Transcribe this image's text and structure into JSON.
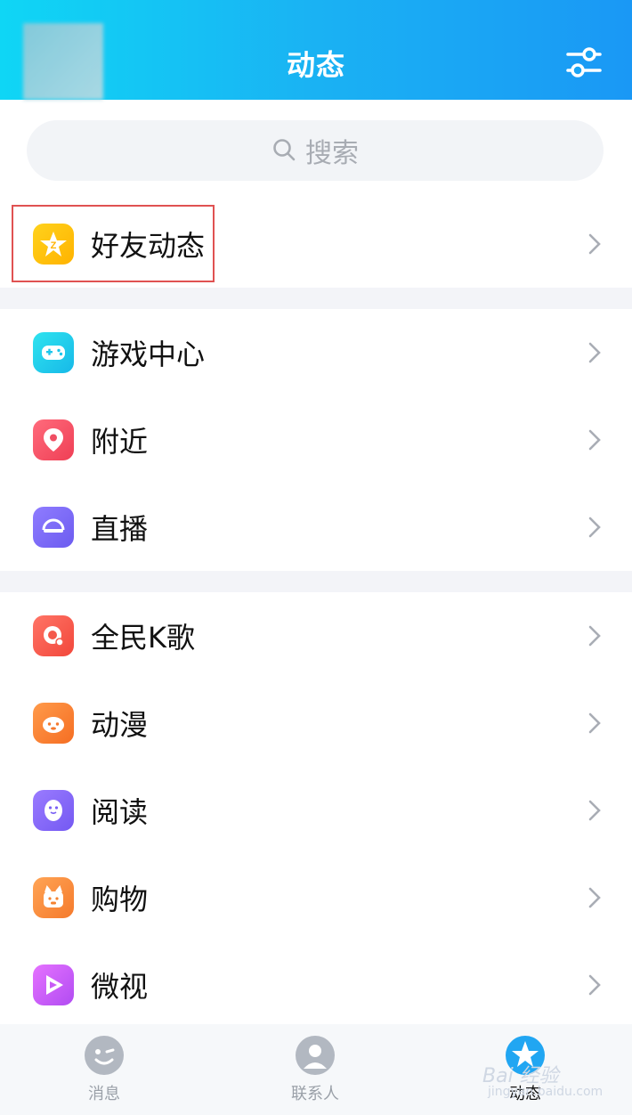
{
  "header": {
    "title": "动态"
  },
  "search": {
    "placeholder": "搜索"
  },
  "items": [
    {
      "label": "好友动态",
      "icon": "qzone-star-icon"
    },
    {
      "label": "游戏中心",
      "icon": "gamepad-icon"
    },
    {
      "label": "附近",
      "icon": "location-pin-icon"
    },
    {
      "label": "直播",
      "icon": "live-icon"
    },
    {
      "label": "全民K歌",
      "icon": "karaoke-icon"
    },
    {
      "label": "动漫",
      "icon": "anime-face-icon"
    },
    {
      "label": "阅读",
      "icon": "reading-penguin-icon"
    },
    {
      "label": "购物",
      "icon": "shopping-bag-icon"
    },
    {
      "label": "微视",
      "icon": "video-play-icon"
    }
  ],
  "tabs": [
    {
      "label": "消息"
    },
    {
      "label": "联系人"
    },
    {
      "label": "动态"
    }
  ],
  "watermark": {
    "line1": "Bai 经验",
    "line2": "jingyan.baidu.com"
  },
  "colors": {
    "header_start": "#0fd6f5",
    "header_end": "#1a98f5",
    "highlight": "#e05252"
  }
}
